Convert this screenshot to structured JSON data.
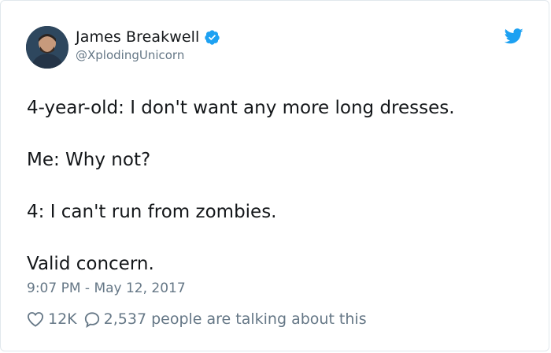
{
  "tweet": {
    "author": {
      "display_name": "James Breakwell",
      "handle": "@XplodingUnicorn",
      "verified": true,
      "avatar_icon": "user-avatar-photo"
    },
    "icons": {
      "verified": "verified-badge-icon",
      "platform": "twitter-bird-icon",
      "like": "heart-icon",
      "reply": "speech-bubble-icon"
    },
    "body": [
      "4-year-old: I don't want any more long dresses.",
      "Me: Why not?",
      "4: I can't run from zombies.",
      "Valid concern."
    ],
    "timestamp": "9:07 PM - May 12, 2017",
    "like_count": "12K",
    "conversation_text": "2,537 people are talking about this"
  },
  "colors": {
    "text": "#14171a",
    "secondary": "#657786",
    "brand_blue": "#1da1f2",
    "border": "#e1e8ed"
  }
}
